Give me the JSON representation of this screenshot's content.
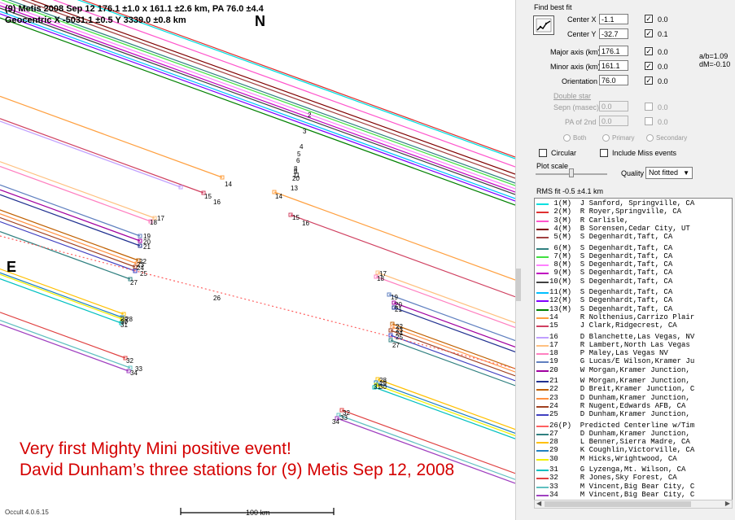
{
  "header": {
    "line1": "(9) Metis  2008 Sep 12   176.1 ±1.0 x 161.1 ±2.6 km, PA 76.0 ±4.4",
    "line2": "Geocentric  X  -5031.1 ±0.5  Y 3339.0 ±0.8 km"
  },
  "compass": {
    "north": "N",
    "east": "E"
  },
  "caption": {
    "line1": "Very first Mighty Mini positive event!",
    "line2": "David Dunham’s three stations for (9) Metis Sep 12, 2008"
  },
  "footer": {
    "version": "Occult 4.0.6.15",
    "scale_label": "100 km"
  },
  "panel": {
    "find_best_fit": "Find best fit",
    "center_x": {
      "label": "Center X",
      "value": "-1.1",
      "checked": true,
      "step": "0.0"
    },
    "center_y": {
      "label": "Center Y",
      "value": "-32.7",
      "checked": true,
      "step": "0.1"
    },
    "major_axis": {
      "label": "Major axis (km)",
      "value": "176.1",
      "checked": true,
      "step": "0.0"
    },
    "minor_axis": {
      "label": "Minor axis (km)",
      "value": "161.1",
      "checked": true,
      "step": "0.0"
    },
    "orientation": {
      "label": "Orientation",
      "value": "76.0",
      "checked": true,
      "step": "0.0"
    },
    "ratio_ab": "a/b=1.09",
    "dm": "dM=-0.10",
    "double_star": "Double star",
    "sepn": {
      "label": "Sepn (masec)",
      "value": "0.0",
      "step": "0.0"
    },
    "pa2": {
      "label": "PA of 2nd",
      "value": "0.0",
      "step": "0.0"
    },
    "radio_both": "Both",
    "radio_primary": "Primary",
    "radio_secondary": "Secondary",
    "circular": "Circular",
    "include_miss": "Include Miss events",
    "plot_scale": "Plot scale",
    "quality_label": "Quality",
    "quality_value": "Not fitted",
    "rms": "RMS fit -0.5 ±4.1 km"
  },
  "observers": [
    {
      "text": " 1(M)  J Sanford, Springville, CA",
      "color": "#00e0e0"
    },
    {
      "text": " 2(M)  R Royer,Springville, CA",
      "color": "#e03030"
    },
    {
      "text": " 3(M)  R Carlisle,",
      "color": "#ff55cc"
    },
    {
      "text": " 4(M)  B Sorensen,Cedar City, UT",
      "color": "#800000"
    },
    {
      "text": " 5(M)  S Degenhardt,Taft, CA",
      "color": "#a04040"
    },
    {
      "text": " 6(M)  S Degenhardt,Taft, CA",
      "color": "#308080"
    },
    {
      "text": " 7(M)  S Degenhardt,Taft, CA",
      "color": "#40e040"
    },
    {
      "text": " 8(M)  S Degenhardt,Taft, CA",
      "color": "#ff80ff"
    },
    {
      "text": " 9(M)  S Degenhardt,Taft, CA",
      "color": "#c000c0"
    },
    {
      "text": "10(M)  S Degenhardt,Taft, CA",
      "color": "#404040"
    },
    {
      "text": "11(M)  S Degenhardt,Taft, CA",
      "color": "#00c0ff"
    },
    {
      "text": "12(M)  S Degenhardt,Taft, CA",
      "color": "#8000ff"
    },
    {
      "text": "13(M)  S Degenhardt,Taft, CA",
      "color": "#008000"
    },
    {
      "text": "14     R Nolthenius,Carrizo Plair",
      "color": "#ffa040"
    },
    {
      "text": "15     J Clark,Ridgecrest, CA",
      "color": "#d04060"
    },
    {
      "text": "16     D Blanchette,Las Vegas, NV",
      "color": "#c0a0ff"
    },
    {
      "text": "17     R Lambert,North Las Vegas",
      "color": "#ffc080"
    },
    {
      "text": "18     P Maley,Las Vegas NV",
      "color": "#ff80c0"
    },
    {
      "text": "19     G Lucas/E Wilson,Kramer Ju",
      "color": "#6080c0"
    },
    {
      "text": "20     W Morgan,Kramer Junction,",
      "color": "#a000a0"
    },
    {
      "text": "21     W Morgan,Kramer Junction,",
      "color": "#203090"
    },
    {
      "text": "22     D Breit,Kramer Junction, C",
      "color": "#c06000"
    },
    {
      "text": "23     D Dunham,Kramer Junction,",
      "color": "#ff9040"
    },
    {
      "text": "24     R Nugent,Edwards AFB, CA",
      "color": "#a04020"
    },
    {
      "text": "25     D Dunham,Kramer Junction,",
      "color": "#4040c0"
    },
    {
      "text": "26(P)  Predicted Centerline w/Tim",
      "color": "#ff6060"
    },
    {
      "text": "27     D Dunham,Kramer Junction,",
      "color": "#308080"
    },
    {
      "text": "28     L Benner,Sierra Madre, CA",
      "color": "#ffc000"
    },
    {
      "text": "29     K Coughlin,Victorville, CA",
      "color": "#2080c0"
    },
    {
      "text": "30     M Hicks,Wrightwood, CA",
      "color": "#f0f000"
    },
    {
      "text": "31     G Lyzenga,Mt. Wilson, CA",
      "color": "#00c0c0"
    },
    {
      "text": "32     R Jones,Sky Forest, CA",
      "color": "#e04040"
    },
    {
      "text": "33     M Vincent,Big Bear City, C",
      "color": "#60c0c0"
    },
    {
      "text": "34     M Vincent,Big Bear City, C",
      "color": "#a040c0"
    }
  ],
  "chart_data": {
    "type": "line",
    "title": "(9) Metis  2008 Sep 12",
    "chords": [
      {
        "id": "1",
        "color": "#00e0e0",
        "label_pos": "2"
      },
      {
        "id": "2",
        "color": "#e03030"
      },
      {
        "id": "3",
        "color": "#ff55cc"
      },
      {
        "id": "4",
        "color": "#800000"
      },
      {
        "id": "5",
        "color": "#a04040"
      },
      {
        "id": "6",
        "color": "#308080"
      },
      {
        "id": "7",
        "color": "#40e040"
      },
      {
        "id": "8",
        "color": "#ff80ff"
      },
      {
        "id": "9",
        "color": "#c000c0"
      },
      {
        "id": "10",
        "color": "#404040"
      },
      {
        "id": "11",
        "color": "#00c0ff"
      },
      {
        "id": "12",
        "color": "#8000ff"
      },
      {
        "id": "13",
        "color": "#008000"
      },
      {
        "id": "14",
        "color": "#ffa040"
      },
      {
        "id": "15",
        "color": "#d04060"
      },
      {
        "id": "16",
        "color": "#c0a0ff"
      },
      {
        "id": "17",
        "color": "#ffc080"
      },
      {
        "id": "18",
        "color": "#ff80c0"
      },
      {
        "id": "19",
        "color": "#6080c0"
      },
      {
        "id": "20",
        "color": "#a000a0"
      },
      {
        "id": "21",
        "color": "#203090"
      },
      {
        "id": "22",
        "color": "#c06000"
      },
      {
        "id": "23",
        "color": "#ff9040"
      },
      {
        "id": "24",
        "color": "#a04020"
      },
      {
        "id": "25",
        "color": "#4040c0"
      },
      {
        "id": "26",
        "color": "#ff6060"
      },
      {
        "id": "27",
        "color": "#308080"
      },
      {
        "id": "28",
        "color": "#ffc000"
      },
      {
        "id": "29",
        "color": "#2080c0"
      },
      {
        "id": "30",
        "color": "#f0f000"
      },
      {
        "id": "31",
        "color": "#00c0c0"
      },
      {
        "id": "32",
        "color": "#e04040"
      },
      {
        "id": "33",
        "color": "#60c0c0"
      },
      {
        "id": "34",
        "color": "#a040c0"
      }
    ],
    "scale_km": 100,
    "plot_labels": [
      "2",
      "3",
      "4",
      "5",
      "6",
      "8",
      "9",
      "20",
      "11",
      "13",
      "14",
      "14",
      "15",
      "16",
      "15",
      "16",
      "17",
      "18",
      "19",
      "20",
      "21",
      "22",
      "23",
      "24",
      "25",
      "27",
      "26",
      "17",
      "18",
      "19",
      "20",
      "21",
      "22",
      "23",
      "24",
      "25",
      "27",
      "28",
      "29",
      "30",
      "31",
      "32",
      "33",
      "34",
      "28",
      "29",
      "30",
      "31",
      "32",
      "33",
      "34"
    ]
  }
}
